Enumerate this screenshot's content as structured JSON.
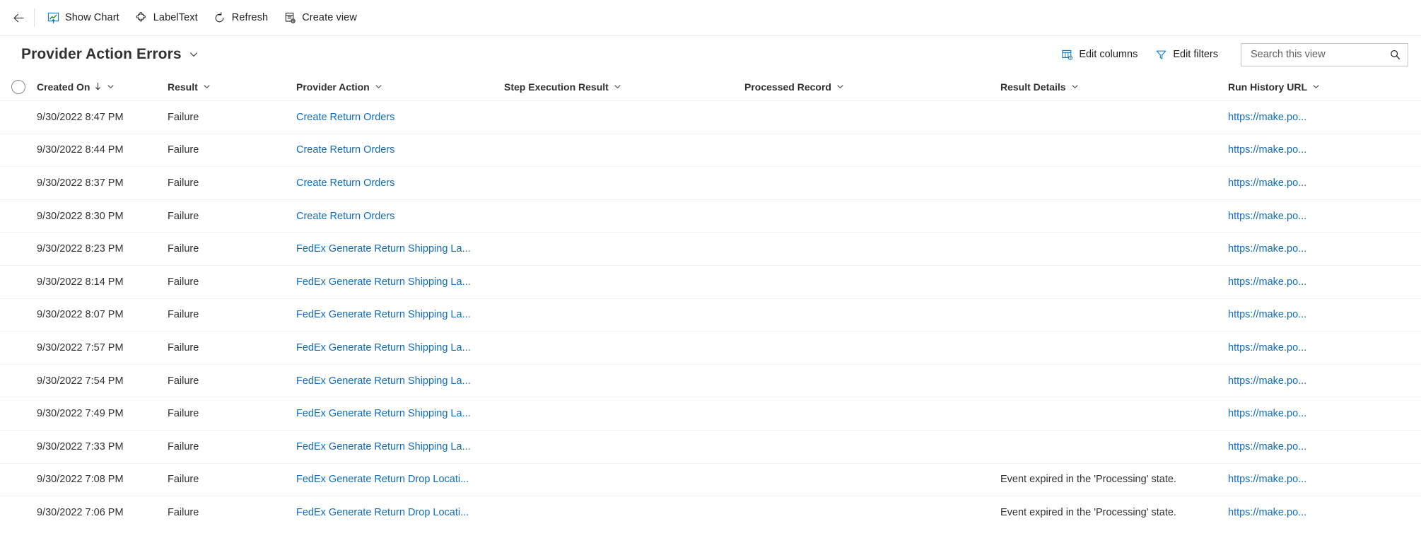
{
  "command_bar": {
    "back_label": "Back",
    "items": [
      {
        "label": "Show Chart",
        "icon": "show-chart-icon"
      },
      {
        "label": "LabelText",
        "icon": "puzzle-piece-icon"
      },
      {
        "label": "Refresh",
        "icon": "refresh-icon"
      },
      {
        "label": "Create view",
        "icon": "create-view-icon"
      }
    ]
  },
  "view_header": {
    "title": "Provider Action Errors",
    "title_chevron_icon": "chevron-down-icon",
    "actions": [
      {
        "label": "Edit columns",
        "icon": "edit-columns-icon"
      },
      {
        "label": "Edit filters",
        "icon": "filter-icon"
      }
    ],
    "search": {
      "placeholder": "Search this view",
      "value": "",
      "icon": "search-icon"
    }
  },
  "grid": {
    "select_all": {
      "icon": "select-all-circle",
      "checked": false
    },
    "columns": [
      {
        "label": "Created On",
        "sorted": true,
        "sort_direction": "desc",
        "sort_icon": "arrow-down-icon"
      },
      {
        "label": "Result",
        "sorted": false
      },
      {
        "label": "Provider Action",
        "sorted": false
      },
      {
        "label": "Step Execution Result",
        "sorted": false
      },
      {
        "label": "Processed Record",
        "sorted": false
      },
      {
        "label": "Result Details",
        "sorted": false
      },
      {
        "label": "Run History URL",
        "sorted": false
      }
    ],
    "rows": [
      {
        "created_on": "9/30/2022 8:47 PM",
        "result": "Failure",
        "provider_action": "Create Return Orders",
        "step_execution_result": "",
        "processed_record": "",
        "result_details": "",
        "run_history_url": "https://make.po..."
      },
      {
        "created_on": "9/30/2022 8:44 PM",
        "result": "Failure",
        "provider_action": "Create Return Orders",
        "step_execution_result": "",
        "processed_record": "",
        "result_details": "",
        "run_history_url": "https://make.po..."
      },
      {
        "created_on": "9/30/2022 8:37 PM",
        "result": "Failure",
        "provider_action": "Create Return Orders",
        "step_execution_result": "",
        "processed_record": "",
        "result_details": "",
        "run_history_url": "https://make.po..."
      },
      {
        "created_on": "9/30/2022 8:30 PM",
        "result": "Failure",
        "provider_action": "Create Return Orders",
        "step_execution_result": "",
        "processed_record": "",
        "result_details": "",
        "run_history_url": "https://make.po..."
      },
      {
        "created_on": "9/30/2022 8:23 PM",
        "result": "Failure",
        "provider_action": "FedEx Generate Return Shipping La...",
        "step_execution_result": "",
        "processed_record": "",
        "result_details": "",
        "run_history_url": "https://make.po..."
      },
      {
        "created_on": "9/30/2022 8:14 PM",
        "result": "Failure",
        "provider_action": "FedEx Generate Return Shipping La...",
        "step_execution_result": "",
        "processed_record": "",
        "result_details": "",
        "run_history_url": "https://make.po..."
      },
      {
        "created_on": "9/30/2022 8:07 PM",
        "result": "Failure",
        "provider_action": "FedEx Generate Return Shipping La...",
        "step_execution_result": "",
        "processed_record": "",
        "result_details": "",
        "run_history_url": "https://make.po..."
      },
      {
        "created_on": "9/30/2022 7:57 PM",
        "result": "Failure",
        "provider_action": "FedEx Generate Return Shipping La...",
        "step_execution_result": "",
        "processed_record": "",
        "result_details": "",
        "run_history_url": "https://make.po..."
      },
      {
        "created_on": "9/30/2022 7:54 PM",
        "result": "Failure",
        "provider_action": "FedEx Generate Return Shipping La...",
        "step_execution_result": "",
        "processed_record": "",
        "result_details": "",
        "run_history_url": "https://make.po..."
      },
      {
        "created_on": "9/30/2022 7:49 PM",
        "result": "Failure",
        "provider_action": "FedEx Generate Return Shipping La...",
        "step_execution_result": "",
        "processed_record": "",
        "result_details": "",
        "run_history_url": "https://make.po..."
      },
      {
        "created_on": "9/30/2022 7:33 PM",
        "result": "Failure",
        "provider_action": "FedEx Generate Return Shipping La...",
        "step_execution_result": "",
        "processed_record": "",
        "result_details": "",
        "run_history_url": "https://make.po..."
      },
      {
        "created_on": "9/30/2022 7:08 PM",
        "result": "Failure",
        "provider_action": "FedEx Generate Return Drop Locati...",
        "step_execution_result": "",
        "processed_record": "",
        "result_details": "Event expired in the 'Processing' state.",
        "run_history_url": "https://make.po..."
      },
      {
        "created_on": "9/30/2022 7:06 PM",
        "result": "Failure",
        "provider_action": "FedEx Generate Return Drop Locati...",
        "step_execution_result": "",
        "processed_record": "",
        "result_details": "Event expired in the 'Processing' state.",
        "run_history_url": "https://make.po..."
      }
    ]
  },
  "colors": {
    "link": "#0f6cbd",
    "text": "#323130",
    "border": "#f3f2f1",
    "accent_blue": "#0078d4",
    "accent_green": "#107c10",
    "accent_orange": "#d83b01"
  }
}
